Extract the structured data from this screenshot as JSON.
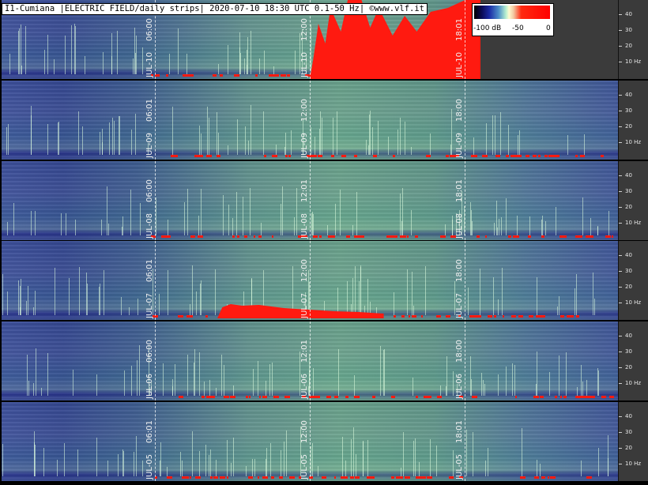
{
  "header": {
    "title": "I1-Cumiana |ELECTRIC FIELD/daily strips| 2020-07-10 18:30 UTC 0.1-50 Hz| ©www.vlf.it"
  },
  "colorbar": {
    "labels": [
      "-100 dB",
      "-50",
      "0"
    ]
  },
  "y_axis": {
    "tick_labels": [
      "40",
      "30",
      "20",
      "10 Hz"
    ]
  },
  "strips": [
    {
      "date": "JUL-10",
      "markers": [
        "06:00",
        "12:00",
        "18:01"
      ],
      "red_bursts": [
        [
          0.5,
          0.78
        ]
      ],
      "partial_fraction": 0.777
    },
    {
      "date": "JUL-09",
      "markers": [
        "06:01",
        "12:00",
        "18:00"
      ],
      "red_bursts": []
    },
    {
      "date": "JUL-08",
      "markers": [
        "06:00",
        "12:01",
        "18:01"
      ],
      "red_bursts": []
    },
    {
      "date": "JUL-07",
      "markers": [
        "06:01",
        "12:00",
        "18:00"
      ],
      "red_bursts": [
        [
          0.35,
          0.62
        ]
      ]
    },
    {
      "date": "JUL-06",
      "markers": [
        "06:00",
        "12:01",
        "18:00"
      ],
      "red_bursts": []
    },
    {
      "date": "JUL-05",
      "markers": [
        "06:01",
        "12:00",
        "18:01"
      ],
      "red_bursts": []
    }
  ],
  "colors": {
    "burst_red": "#ff1a10",
    "background": "#3a3a3a"
  }
}
